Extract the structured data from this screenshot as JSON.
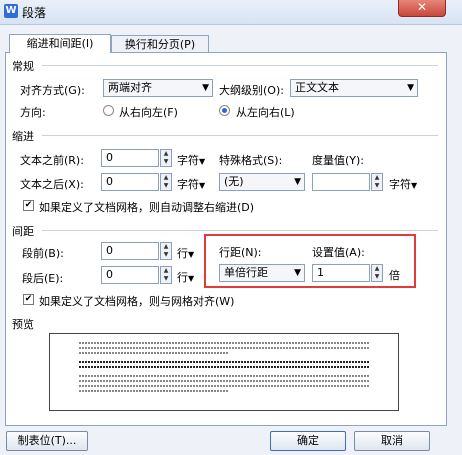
{
  "window": {
    "title": "段落",
    "app_icon_letter": "W",
    "close_glyph": "✕"
  },
  "tabs": [
    {
      "label": "缩进和间距(I)"
    },
    {
      "label": "换行和分页(P)"
    }
  ],
  "general": {
    "section": "常规",
    "alignment_label": "对齐方式(G):",
    "alignment_value": "两端对齐",
    "outline_label": "大纲级别(O):",
    "outline_value": "正文文本",
    "direction_label": "方向:",
    "rtl_label": "从右向左(F)",
    "ltr_label": "从左向右(L)",
    "direction_selected": "ltr"
  },
  "indent": {
    "section": "缩进",
    "before_label": "文本之前(R):",
    "before_value": "0",
    "before_unit": "字符",
    "after_label": "文本之后(X):",
    "after_value": "0",
    "after_unit": "字符",
    "special_label": "特殊格式(S):",
    "special_value": "(无)",
    "measure_label": "度量值(Y):",
    "measure_value": "",
    "measure_unit": "字符",
    "grid_check_label": "如果定义了文档网格，则自动调整右缩进(D)",
    "grid_checked": true
  },
  "spacing": {
    "section": "间距",
    "before_label": "段前(B):",
    "before_value": "0",
    "before_unit": "行",
    "after_label": "段后(E):",
    "after_value": "0",
    "after_unit": "行",
    "line_label": "行距(N):",
    "line_value": "单倍行距",
    "setting_label": "设置值(A):",
    "setting_value": "1",
    "setting_unit": "倍",
    "grid_check_label": "如果定义了文档网格，则与网格对齐(W)",
    "grid_checked": true
  },
  "preview": {
    "section": "预览"
  },
  "buttons": {
    "tabs": "制表位(T)...",
    "ok": "确定",
    "cancel": "取消"
  },
  "colors": {
    "highlight_box": "#e23b3b",
    "accent": "#2a6ad0"
  },
  "icons": {
    "checkmark": "✔",
    "spin_up": "▲",
    "spin_down": "▼",
    "dropdown": "▼"
  }
}
